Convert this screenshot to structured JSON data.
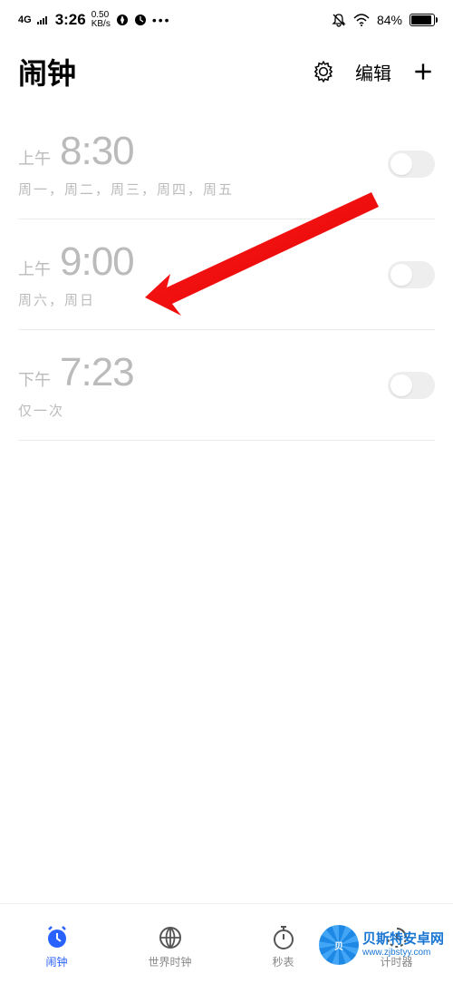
{
  "status_bar": {
    "network": "4G",
    "time": "3:26",
    "speed": "0.50",
    "speed_unit": "KB/s",
    "battery_pct": "84%"
  },
  "header": {
    "title": "闹钟",
    "edit_label": "编辑"
  },
  "alarms": [
    {
      "period": "上午",
      "time": "8:30",
      "repeat": "周一，周二，周三，周四，周五",
      "enabled": false
    },
    {
      "period": "上午",
      "time": "9:00",
      "repeat": "周六，周日",
      "enabled": false
    },
    {
      "period": "下午",
      "time": "7:23",
      "repeat": "仅一次",
      "enabled": false
    }
  ],
  "nav": {
    "alarm": "闹钟",
    "world": "世界时钟",
    "stopwatch": "秒表",
    "timer": "计时器"
  },
  "watermark": {
    "line1": "贝斯特安卓网",
    "line2": "www.zjbstyy.com"
  }
}
